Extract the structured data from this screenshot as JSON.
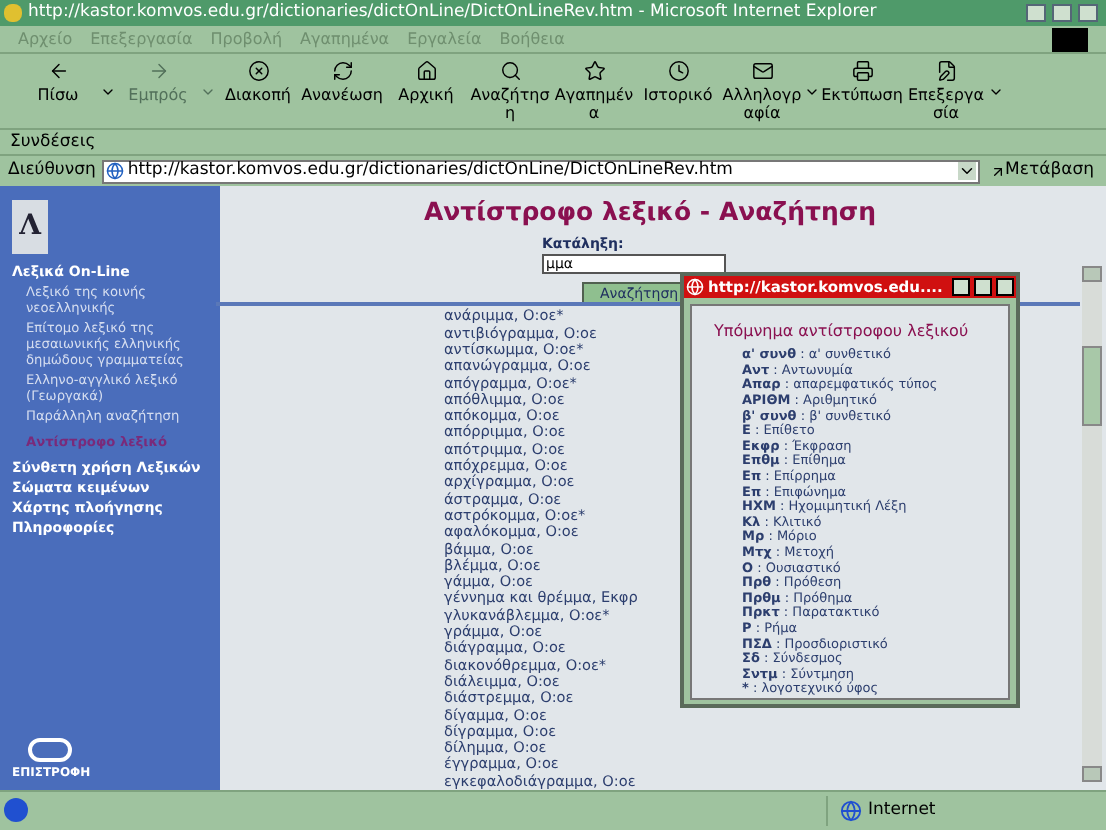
{
  "window": {
    "title": "http://kastor.komvos.edu.gr/dictionaries/dictOnLine/DictOnLineRev.htm - Microsoft Internet Explorer"
  },
  "menu": [
    "Αρχείο",
    "Επεξεργασία",
    "Προβολή",
    "Αγαπημένα",
    "Εργαλεία",
    "Βοήθεια"
  ],
  "toolbar": [
    {
      "kind": "back",
      "label": "Πίσω",
      "disabled": false,
      "dropdown": true
    },
    {
      "kind": "forward",
      "label": "Εμπρός",
      "disabled": true,
      "dropdown": true
    },
    {
      "kind": "stop",
      "label": "Διακοπή",
      "disabled": false,
      "dropdown": false
    },
    {
      "kind": "refresh",
      "label": "Ανανέωση",
      "disabled": false,
      "dropdown": false
    },
    {
      "kind": "home",
      "label": "Αρχική",
      "disabled": false,
      "dropdown": false
    },
    {
      "kind": "search",
      "label": "Αναζήτηση",
      "disabled": false,
      "dropdown": false
    },
    {
      "kind": "favorites",
      "label": "Αγαπημένα",
      "disabled": false,
      "dropdown": false
    },
    {
      "kind": "history",
      "label": "Ιστορικό",
      "disabled": false,
      "dropdown": false
    },
    {
      "kind": "mail",
      "label": "Αλληλογραφία",
      "disabled": false,
      "dropdown": true
    },
    {
      "kind": "print",
      "label": "Εκτύπωση",
      "disabled": false,
      "dropdown": false
    },
    {
      "kind": "edit",
      "label": "Επεξεργασία",
      "disabled": false,
      "dropdown": true
    }
  ],
  "links_bar": {
    "label": "Συνδέσεις"
  },
  "address_bar": {
    "label": "Διεύθυνση",
    "value": "http://kastor.komvos.edu.gr/dictionaries/dictOnLine/DictOnLineRev.htm",
    "go": "Μετάβαση"
  },
  "sidebar": {
    "logo": "Λ",
    "items": [
      {
        "label": "Λεξικά On-Line",
        "children": [
          {
            "label": "Λεξικό της κοινής νεοελληνικής",
            "selected": false
          },
          {
            "label": "Επίτομο λεξικό της μεσαιωνικής ελληνικής δημώδους γραμματείας",
            "selected": false
          },
          {
            "label": "Ελληνο-αγγλικό λεξικό (Γεωργακά)",
            "selected": false
          },
          {
            "label": "Παράλληλη αναζήτηση",
            "selected": false
          },
          {
            "label": "Αντίστροφο λεξικό",
            "selected": true
          }
        ]
      },
      {
        "label": "Σύνθετη χρήση Λεξικών"
      },
      {
        "label": "Σώματα κειμένων"
      },
      {
        "label": "Χάρτης πλοήγησης"
      },
      {
        "label": "Πληροφορίες"
      }
    ],
    "footer": "ΕΠΙΣΤΡΟΦΗ"
  },
  "main": {
    "heading": "Αντίστροφο λεξικό - Αναζήτηση",
    "field_label": "Κατάληξη:",
    "field_value": "μμα",
    "button": "Αναζήτηση",
    "results": [
      "ανάριμμα, Ο:οε*",
      "αντιβιόγραμμα, Ο:οε",
      "αντίσκωμμα, Ο:οε*",
      "απανώγραμμα, Ο:οε",
      "απόγραμμα, Ο:οε*",
      "απόθλιμμα, Ο:οε",
      "απόκομμα, Ο:οε",
      "απόρριμμα, Ο:οε",
      "απότριμμα, Ο:οε",
      "απόχρεμμα, Ο:οε",
      "αρχίγραμμα, Ο:οε",
      "άστραμμα, Ο:οε",
      "αστρόκομμα, Ο:οε*",
      "αφαλόκομμα, Ο:οε",
      "βάμμα, Ο:οε",
      "βλέμμα, Ο:οε",
      "γάμμα, Ο:οε",
      "γέννημα και θρέμμα, Εκφρ",
      "γλυκανάβλεμμα, Ο:οε*",
      "γράμμα, Ο:οε",
      "διάγραμμα, Ο:οε",
      "διακονόθρεμμα, Ο:οε*",
      "διάλειμμα, Ο:οε",
      "διάστρεμμα, Ο:οε",
      "δίγαμμα, Ο:οε",
      "δίγραμμα, Ο:οε",
      "δίλημμα, Ο:οε",
      "έγγραμμα, Ο:οε",
      "εγκεφαλοδιάγραμμα, Ο:οε"
    ]
  },
  "popup": {
    "title": "http://kastor.komvos.edu....",
    "heading": "Υπόμνημα αντίστροφου λεξικού",
    "legend": [
      "**α' συνθ** : α' συνθετικό",
      "**Αντ** : Αντωνυμία",
      "**Απαρ** : απαρεμφατικός τύπος",
      "**ΑΡΙΘΜ** : Αριθμητικό",
      "**β' συνθ** : β' συνθετικό",
      "**Ε** : Επίθετο",
      "**Εκφρ** : Έκφραση",
      "**Επθμ** : Επίθημα",
      "**Επ** : Επίρρημα",
      "**Επ** : Επιφώνημα",
      "**ΗΧΜ** : Ηχομιμητική Λέξη",
      "**Κλ** : Κλιτικό",
      "**Μρ** : Μόριο",
      "**Μτχ** : Μετοχή",
      "**Ο** : Ουσιαστικό",
      "**Πρθ** : Πρόθεση",
      "**Πρθμ** : Πρόθημα",
      "**Πρκτ** : Παρατακτικό",
      "**Ρ** : Ρήμα",
      "**ΠΣΔ** : Προσδιοριστικό",
      "**Σδ** : Σύνδεσμος",
      "**Σντμ** : Σύντμηση",
      "***** : λογοτεχνικό ύφος"
    ]
  },
  "status_bar": {
    "zone": "Internet"
  }
}
